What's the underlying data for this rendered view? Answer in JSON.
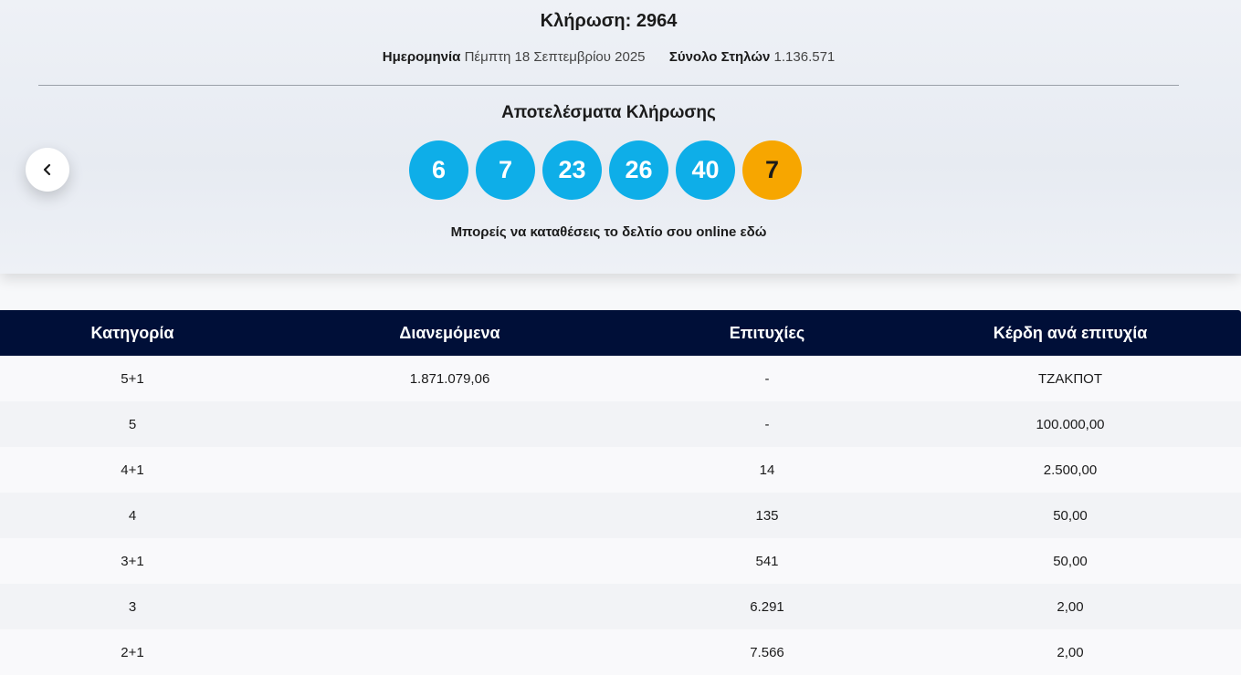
{
  "header": {
    "title": "Κλήρωση: 2964",
    "date_label": "Ημερομηνία",
    "date_value": "Πέμπτη 18 Σεπτεμβρίου 2025",
    "columns_label": "Σύνολο Στηλών",
    "columns_value": "1.136.571"
  },
  "results": {
    "title": "Αποτελέσματα Κλήρωσης",
    "numbers": [
      "6",
      "7",
      "23",
      "26",
      "40"
    ],
    "bonus": "7",
    "online_text": "Μπορείς να καταθέσεις το δελτίο σου online εδώ"
  },
  "nav": {
    "prev_icon": "chevron-left-icon"
  },
  "colors": {
    "ball": "#0eaee8",
    "bonus_ball": "#f7a600",
    "table_header": "#000f38"
  },
  "table": {
    "headers": [
      "Κατηγορία",
      "Διανεμόμενα",
      "Επιτυχίες",
      "Κέρδη ανά επιτυχία"
    ],
    "rows": [
      [
        "5+1",
        "1.871.079,06",
        "-",
        "ΤΖΑΚΠΟΤ"
      ],
      [
        "5",
        "",
        "-",
        "100.000,00"
      ],
      [
        "4+1",
        "",
        "14",
        "2.500,00"
      ],
      [
        "4",
        "",
        "135",
        "50,00"
      ],
      [
        "3+1",
        "",
        "541",
        "50,00"
      ],
      [
        "3",
        "",
        "6.291",
        "2,00"
      ],
      [
        "2+1",
        "",
        "7.566",
        "2,00"
      ]
    ]
  }
}
